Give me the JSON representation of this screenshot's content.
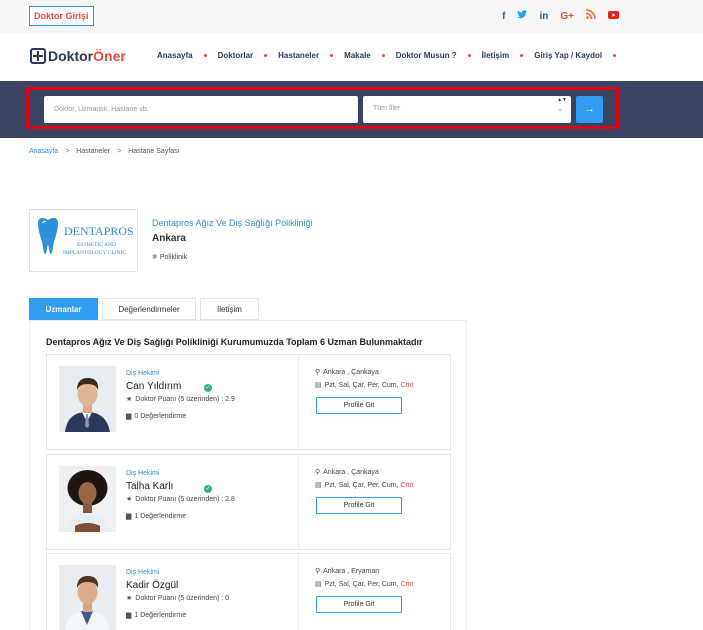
{
  "topbar": {
    "doctor_login": "Doktor Girişi",
    "social_icons": [
      {
        "name": "facebook-icon",
        "glyph": "f",
        "color": "#1f6fc5"
      },
      {
        "name": "twitter-icon",
        "glyph": "🐦",
        "color": "#1da1f2"
      },
      {
        "name": "linkedin-icon",
        "glyph": "in",
        "color": "#0a66c2"
      },
      {
        "name": "google-plus-icon",
        "glyph": "G+",
        "color": "#dd4b39"
      },
      {
        "name": "rss-icon",
        "glyph": "◔",
        "color": "#f26522"
      },
      {
        "name": "youtube-icon",
        "glyph": "▶",
        "color": "#e62117"
      }
    ]
  },
  "logo": {
    "part1": "Doktor",
    "part2": "Öner"
  },
  "menu": {
    "items": [
      "Anasayfa",
      "Doktorlar",
      "Hastaneler",
      "Makale",
      "Doktor Musun ?",
      "İletişim",
      "Giriş Yap / Kaydol"
    ]
  },
  "search": {
    "placeholder": "Doktor, Uzmanlık, Hastane vb.",
    "city_selected": "Tüm İller",
    "submit_glyph": "→"
  },
  "breadcrumb": {
    "items": [
      "Anasayfa",
      "Hastaneler",
      "Hastane Sayfası"
    ],
    "separator": ">"
  },
  "hospital": {
    "logo_text_main": "DENTAPROS",
    "logo_text_sub1": "ESTHETIC AND",
    "logo_text_sub2": "IMPLANTOLOGY CLINIC",
    "name": "Dentapros Ağız Ve Diş Sağlığı Polikliniği",
    "city": "Ankara",
    "type": "Poliklinik"
  },
  "tabs": [
    "Uzmanlar",
    "Değerlendirmeler",
    "İletişim"
  ],
  "panel": {
    "title": "Dentapros Ağız Ve Diş Sağlığı Polikliniği Kurumumuzda Toplam 6 Uzman Bulunmaktadır"
  },
  "doctors": [
    {
      "branch": "Diş Hekimi",
      "name": "Can Yıldırım",
      "verified": true,
      "score": "Doktor Puanı (5 üzerinden) : 2.9",
      "reviews": "0 Değerlendirme",
      "location": "Ankara , Çankaya",
      "days": "Pzt, Sal, Çar, Per, Cum,",
      "days_extra": "Cmt",
      "button": "Profile Git"
    },
    {
      "branch": "Diş Hekimi",
      "name": "Talha Karlı",
      "verified": true,
      "score": "Doktor Puanı (5 üzerinden) : 2.8",
      "reviews": "1 Değerlendirme",
      "location": "Ankara , Çankaya",
      "days": "Pzt, Sal, Çar, Per, Cum,",
      "days_extra": "Cmt",
      "button": "Profile Git"
    },
    {
      "branch": "Diş Hekimi",
      "name": "Kadir Özgül",
      "verified": false,
      "score": "Doktor Puanı (5 üzerinden) : 0",
      "reviews": "1 Değerlendirme",
      "location": "Ankara , Eryaman",
      "days": "Pzt, Sal, Çar, Per, Cum,",
      "days_extra": "Cmt",
      "button": "Profile Git"
    }
  ],
  "colors": {
    "accent_blue": "#2f9cf0",
    "brand_red": "#e84a3b",
    "navy": "#2d3a55",
    "search_band": "#3a4460",
    "highlight_outline": "#e00012"
  }
}
